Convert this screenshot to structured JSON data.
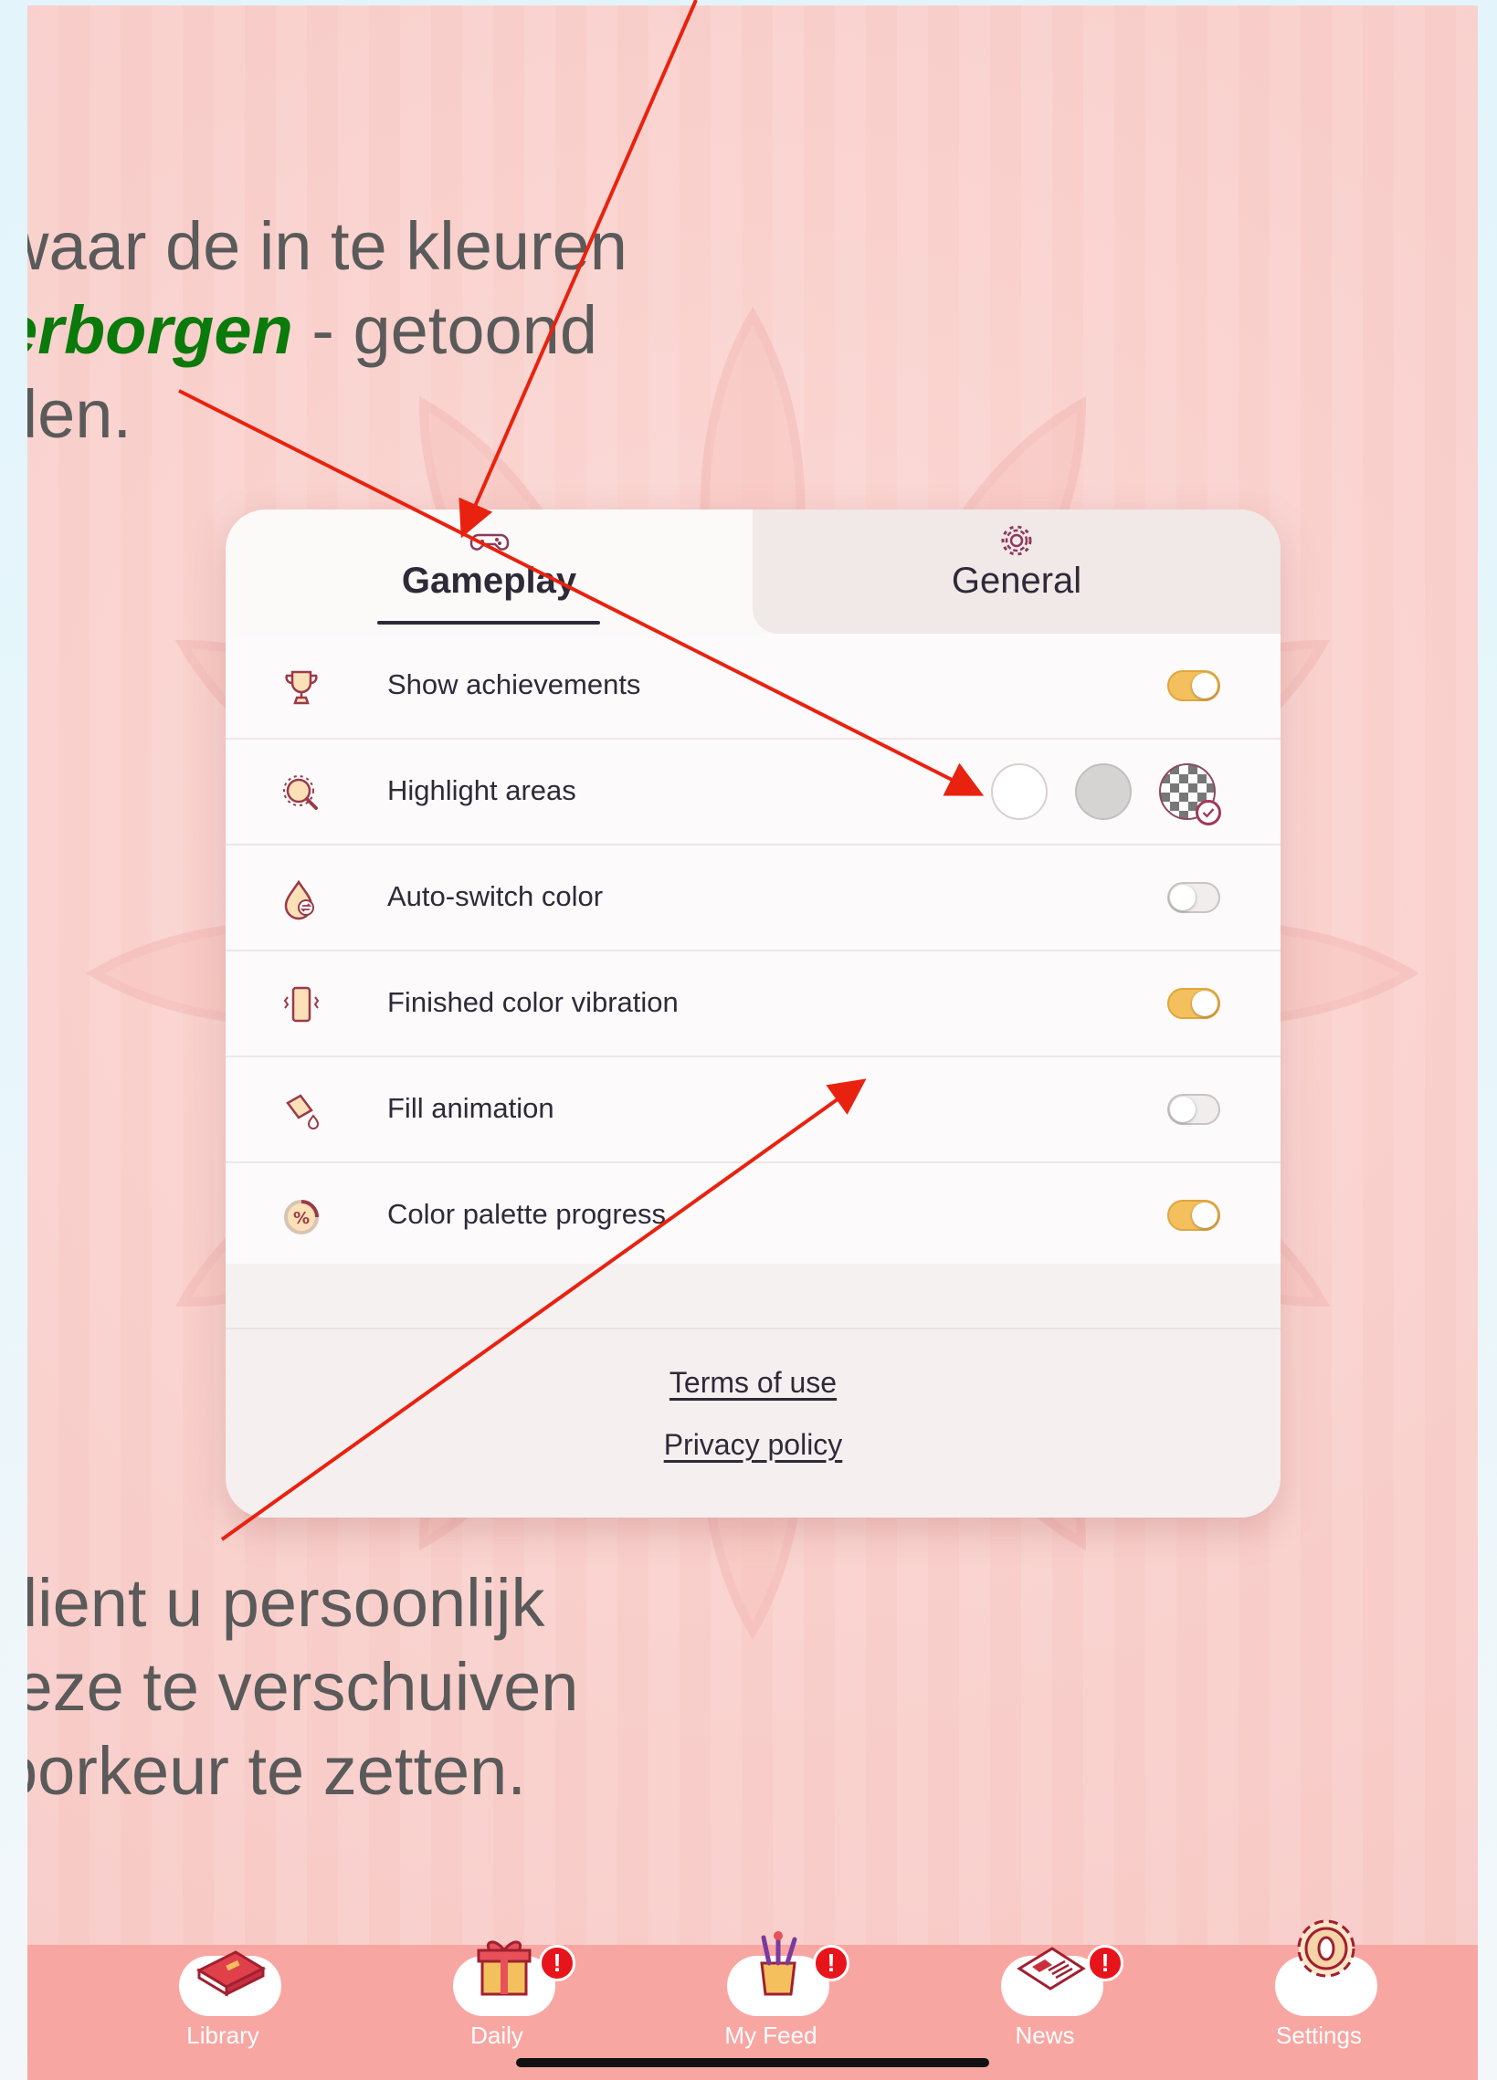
{
  "instruction_top": {
    "line1": "waar de in te kleuren",
    "line2_emph": "erborgen",
    "line2_rest": " - getoond",
    "line3": "den."
  },
  "instruction_bottom": {
    "line1": "dient u persoonlijk",
    "line2": "leze te verschuiven",
    "line3": "oorkeur te zetten."
  },
  "tabs": [
    {
      "label": "Gameplay",
      "icon": "gamepad-icon",
      "active": true
    },
    {
      "label": "General",
      "icon": "gear-icon",
      "active": false
    }
  ],
  "settings": [
    {
      "label": "Show achievements",
      "icon": "trophy-icon",
      "control": "toggle",
      "on": true
    },
    {
      "label": "Highlight areas",
      "icon": "magnifier-icon",
      "control": "options",
      "options": [
        "white",
        "gray",
        "checker"
      ],
      "selected": "checker"
    },
    {
      "label": "Auto-switch color",
      "icon": "drop-switch-icon",
      "control": "toggle",
      "on": false
    },
    {
      "label": "Finished color vibration",
      "icon": "phone-vibrate-icon",
      "control": "toggle",
      "on": true
    },
    {
      "label": "Fill animation",
      "icon": "paint-bucket-icon",
      "control": "toggle",
      "on": false
    },
    {
      "label": "Color palette progress",
      "icon": "percent-circle-icon",
      "control": "toggle",
      "on": true
    }
  ],
  "footer": {
    "terms": "Terms of use",
    "privacy": "Privacy policy"
  },
  "nav": [
    {
      "label": "Library",
      "icon": "book-icon",
      "badge": ""
    },
    {
      "label": "Daily",
      "icon": "gift-icon",
      "badge": "!"
    },
    {
      "label": "My Feed",
      "icon": "paint-cup-icon",
      "badge": "!"
    },
    {
      "label": "News",
      "icon": "newspaper-icon",
      "badge": "!"
    },
    {
      "label": "Settings",
      "icon": "gear-icon",
      "badge": ""
    }
  ],
  "colors": {
    "accent_toggle": "#f4c05e",
    "nav_bg": "#f8a6a2",
    "emphasis_green": "#0a7a0a",
    "annotation_arrow": "#e8220f"
  }
}
